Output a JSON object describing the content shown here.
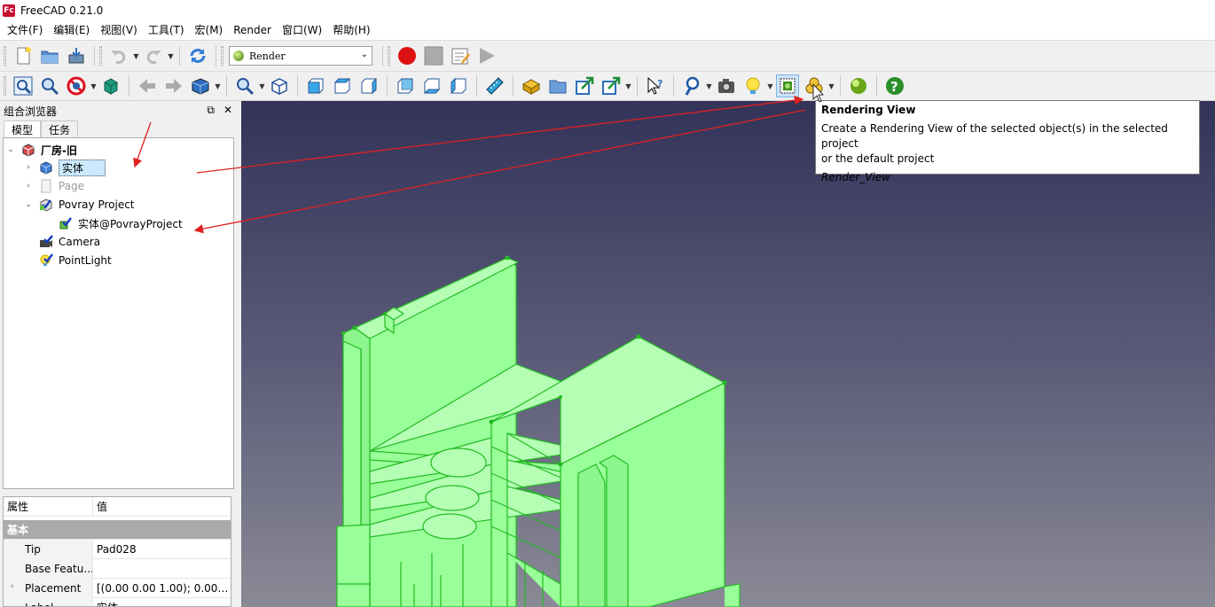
{
  "app": {
    "title": "FreeCAD 0.21.0",
    "logo_text": "Fc"
  },
  "menu": [
    "文件(F)",
    "编辑(E)",
    "视图(V)",
    "工具(T)",
    "宏(M)",
    "Render",
    "窗口(W)",
    "帮助(H)"
  ],
  "toolbar": {
    "workbench_combo_value": "Render"
  },
  "panel": {
    "title": "组合浏览器",
    "tabs": [
      "模型",
      "任务"
    ],
    "tree": [
      {
        "label": "厂房-旧",
        "expanded": true
      },
      {
        "label": "实体",
        "selected": true
      },
      {
        "label": "Page"
      },
      {
        "label": "Povray Project",
        "expanded": true
      },
      {
        "label": "实体@PovrayProject"
      },
      {
        "label": "Camera"
      },
      {
        "label": "PointLight"
      }
    ]
  },
  "properties": {
    "col_property": "属性",
    "col_value": "值",
    "group": "基本",
    "rows": [
      {
        "name": "Tip",
        "value": "Pad028"
      },
      {
        "name": "Base Featu...",
        "value": ""
      },
      {
        "name": "Placement",
        "value": "[(0.00 0.00 1.00); 0.000 ..."
      },
      {
        "name": "Label",
        "value": "实体"
      }
    ]
  },
  "tooltip": {
    "title": "Rendering View",
    "description_line1": "Create a Rendering View of the selected object(s) in the selected project",
    "description_line2": "or the default project",
    "command": "Render_View"
  },
  "colors": {
    "model_fill": "#99ff99",
    "model_edge": "#33cc33",
    "annotation_arrow": "#e02020",
    "record_button": "#dd1111"
  }
}
